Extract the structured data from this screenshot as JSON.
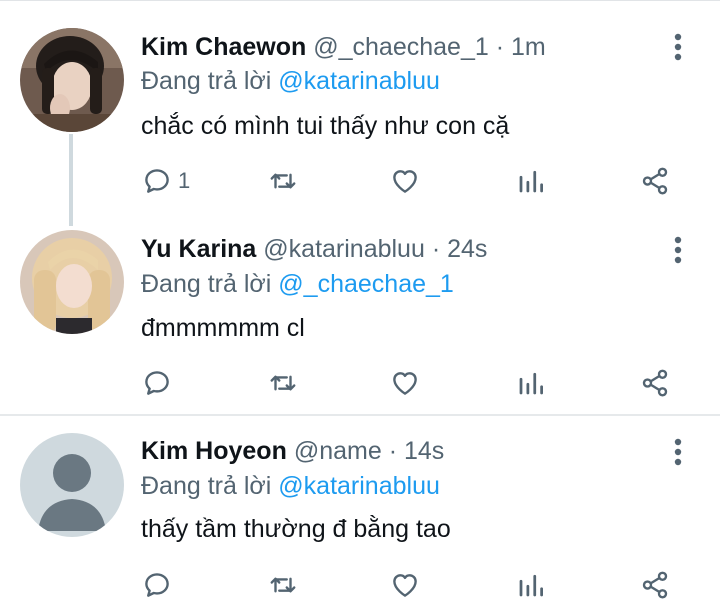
{
  "tweets": [
    {
      "name": "Kim Chaewon",
      "handle": "@_chaechae_1",
      "separator": "·",
      "time": "1m",
      "reply_prefix": "Đang trả lời",
      "reply_to": "@katarinabluu",
      "text": "chắc có mình tui thấy như con cặ",
      "reply_count": "1"
    },
    {
      "name": "Yu Karina",
      "handle": "@katarinabluu",
      "separator": "·",
      "time": "24s",
      "reply_prefix": "Đang trả lời",
      "reply_to": "@_chaechae_1",
      "text": "đmmmmmm cl",
      "reply_count": ""
    },
    {
      "name": "Kim Hoyeon",
      "handle": "@name",
      "separator": "·",
      "time": "14s",
      "reply_prefix": "Đang trả lời",
      "reply_to": "@katarinabluu",
      "text": "thấy tầm thường đ bằng tao",
      "reply_count": ""
    }
  ],
  "colors": {
    "accent": "#1d9bf0",
    "secondary_text": "#536471",
    "primary_text": "#0f1419",
    "thread_line": "#cfd9de"
  },
  "icons": [
    "reply-icon",
    "retweet-icon",
    "like-icon",
    "analytics-icon",
    "share-icon",
    "more-options-icon"
  ]
}
